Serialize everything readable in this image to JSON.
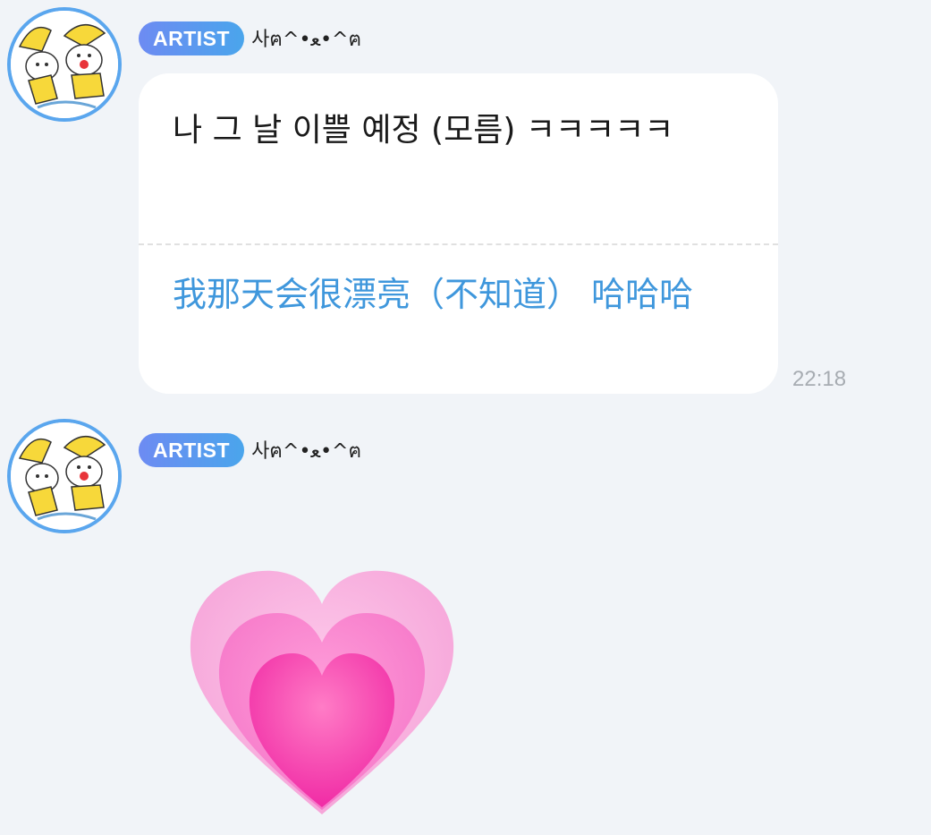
{
  "messages": [
    {
      "badge": "ARTIST",
      "sender": "사ฅ^•ﻌ•^ฅ",
      "original_text": "나 그 날 이쁠 예정 (모름) ㅋㅋㅋㅋㅋ",
      "translated_text": "我那天会很漂亮（不知道） 哈哈哈",
      "time": "22:18"
    },
    {
      "badge": "ARTIST",
      "sender": "사ฅ^•ﻌ•^ฅ",
      "sticker": "growing-heart-sticker"
    }
  ],
  "colors": {
    "background": "#f1f4f8",
    "badge_gradient_start": "#6d8bf2",
    "badge_gradient_end": "#4aa5ec",
    "translation_text": "#3f97dc",
    "avatar_ring": "#5aa6ee",
    "heart_pink": "#ff3fb0"
  }
}
